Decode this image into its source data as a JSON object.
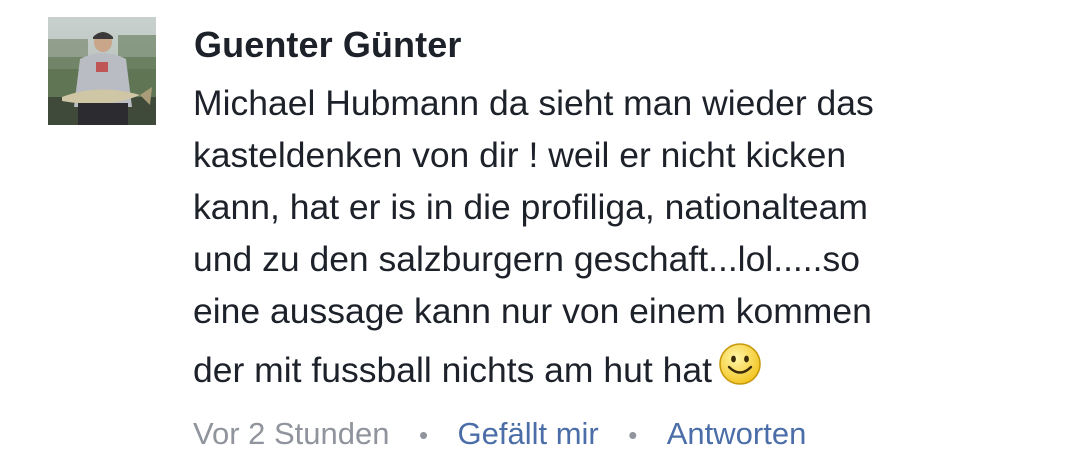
{
  "comment": {
    "author": "Guenter Günter",
    "text_lines": [
      "Michael Hubmann da sieht man wieder das",
      "kasteldenken von dir ! weil er nicht kicken",
      "kann, hat er is in die profiliga, nationalteam",
      "und zu den salzburgern geschaft...lol.....so",
      "eine aussage kann nur von einem kommen",
      "der mit fussball nichts am hut hat"
    ],
    "emoji": "smiley-emoji",
    "meta": {
      "timestamp": "Vor 2 Stunden",
      "separator": "•",
      "like_label": "Gefällt mir",
      "reply_label": "Antworten"
    }
  },
  "colors": {
    "author": "#1d2129",
    "text": "#1d2129",
    "timestamp": "#90949c",
    "action_link": "#4b6ea8"
  }
}
